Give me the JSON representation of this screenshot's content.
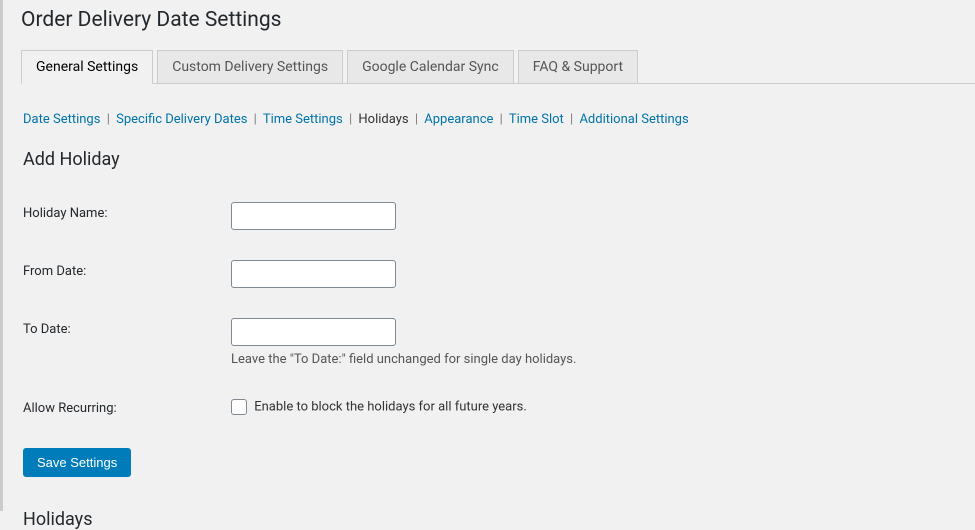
{
  "page_title": "Order Delivery Date Settings",
  "tabs": [
    {
      "label": "General Settings",
      "active": true
    },
    {
      "label": "Custom Delivery Settings",
      "active": false
    },
    {
      "label": "Google Calendar Sync",
      "active": false
    },
    {
      "label": "FAQ & Support",
      "active": false
    }
  ],
  "sub_tabs": {
    "date_settings": "Date Settings",
    "specific_dates": "Specific Delivery Dates",
    "time_settings": "Time Settings",
    "holidays": "Holidays",
    "appearance": "Appearance",
    "time_slot": "Time Slot",
    "additional": "Additional Settings"
  },
  "section": {
    "title": "Add Holiday",
    "holiday_name_label": "Holiday Name:",
    "holiday_name_value": "",
    "from_date_label": "From Date:",
    "from_date_value": "",
    "to_date_label": "To Date:",
    "to_date_value": "",
    "to_date_desc": "Leave the \"To Date:\" field unchanged for single day holidays.",
    "allow_recurring_label": "Allow Recurring:",
    "recurring_checkbox_desc": "Enable to block the holidays for all future years."
  },
  "buttons": {
    "save": "Save Settings"
  },
  "holidays_title": "Holidays"
}
